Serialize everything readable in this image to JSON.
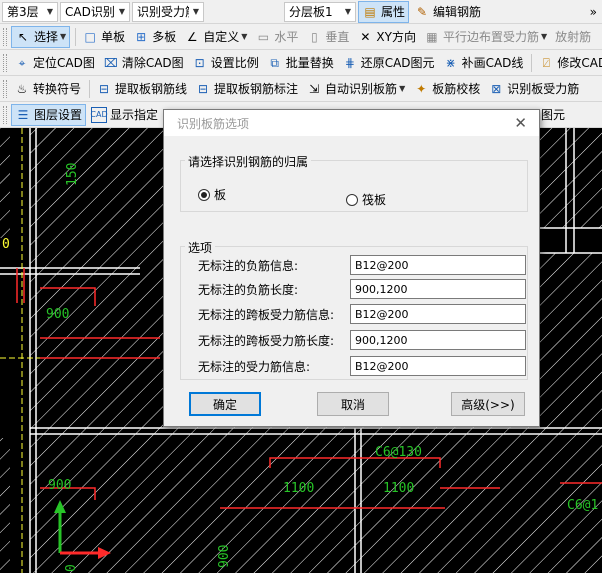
{
  "toolbar1": {
    "floor": "第3层",
    "cad_recog": "CAD识别",
    "recog_type": "识别受力筋",
    "component": "分层板1",
    "properties": "属性",
    "edit_rebar": "编辑钢筋",
    "more": "»"
  },
  "toolbar2": {
    "select": "选择",
    "single_slab": "单板",
    "multi_slab": "多板",
    "custom": "自定义",
    "horizontal": "水平",
    "vertical": "垂直",
    "xy_dir": "XY方向",
    "parallel_edge": "平行边布置受力筋",
    "radial": "放射筋"
  },
  "toolbar3": {
    "locate_cad": "定位CAD图",
    "clear_cad": "清除CAD图",
    "set_scale": "设置比例",
    "batch_replace": "批量替换",
    "restore_cad": "还原CAD图元",
    "draw_cad_line": "补画CAD线",
    "modify_cad": "修改CAD"
  },
  "toolbar4": {
    "convert_symbol": "转换符号",
    "extract_slab_line": "提取板钢筋线",
    "extract_slab_label": "提取板钢筋标注",
    "auto_recog": "自动识别板筋",
    "slab_check": "板筋校核",
    "recog_slab_force": "识别板受力筋"
  },
  "toolbar5": {
    "layer_settings": "图层设置",
    "show_specified": "显示指定",
    "graphic_element_tail": "图元"
  },
  "canvas": {
    "labels": [
      "150",
      "900",
      "900",
      "C6@130",
      "1100",
      "1100",
      "C6@1",
      "900",
      "0",
      "0"
    ],
    "colors": {
      "hatch": "#ffffff",
      "red": "#ff2a2a",
      "green": "#27c427",
      "yellow": "#ffff33"
    }
  },
  "dialog": {
    "title": "识别板筋选项",
    "belong_group": "请选择识别钢筋的归属",
    "opt_slab": "板",
    "opt_raft": "筏板",
    "selected": "板",
    "options_group": "选项",
    "fields": [
      {
        "label": "无标注的负筋信息:",
        "value": "B12@200"
      },
      {
        "label": "无标注的负筋长度:",
        "value": "900,1200"
      },
      {
        "label": "无标注的跨板受力筋信息:",
        "value": "B12@200"
      },
      {
        "label": "无标注的跨板受力筋长度:",
        "value": "900,1200"
      },
      {
        "label": "无标注的受力筋信息:",
        "value": "B12@200"
      }
    ],
    "ok": "确定",
    "cancel": "取消",
    "advanced": "高级(>>)"
  }
}
